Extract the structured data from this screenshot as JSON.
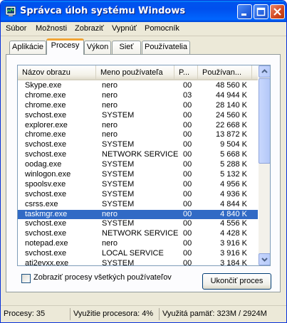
{
  "window": {
    "title": "Správca úloh systému Windows"
  },
  "menu": [
    "Súbor",
    "Možnosti",
    "Zobraziť",
    "Vypnúť",
    "Pomocník"
  ],
  "tabs": [
    "Aplikácie",
    "Procesy",
    "Výkon",
    "Sieť",
    "Používatelia"
  ],
  "active_tab": "Procesy",
  "columns": [
    "Názov obrazu",
    "Meno používateľa",
    "P...",
    "Používan..."
  ],
  "processes": [
    {
      "name": "Skype.exe",
      "user": "nero",
      "cpu": "00",
      "mem": "48 560 K"
    },
    {
      "name": "chrome.exe",
      "user": "nero",
      "cpu": "03",
      "mem": "44 944 K"
    },
    {
      "name": "chrome.exe",
      "user": "nero",
      "cpu": "00",
      "mem": "28 140 K"
    },
    {
      "name": "svchost.exe",
      "user": "SYSTEM",
      "cpu": "00",
      "mem": "24 560 K"
    },
    {
      "name": "explorer.exe",
      "user": "nero",
      "cpu": "00",
      "mem": "22 668 K"
    },
    {
      "name": "chrome.exe",
      "user": "nero",
      "cpu": "00",
      "mem": "13 872 K"
    },
    {
      "name": "svchost.exe",
      "user": "SYSTEM",
      "cpu": "00",
      "mem": "9 504 K"
    },
    {
      "name": "svchost.exe",
      "user": "NETWORK SERVICE",
      "cpu": "00",
      "mem": "5 668 K"
    },
    {
      "name": "oodag.exe",
      "user": "SYSTEM",
      "cpu": "00",
      "mem": "5 288 K"
    },
    {
      "name": "winlogon.exe",
      "user": "SYSTEM",
      "cpu": "00",
      "mem": "5 132 K"
    },
    {
      "name": "spoolsv.exe",
      "user": "SYSTEM",
      "cpu": "00",
      "mem": "4 956 K"
    },
    {
      "name": "svchost.exe",
      "user": "SYSTEM",
      "cpu": "00",
      "mem": "4 936 K"
    },
    {
      "name": "csrss.exe",
      "user": "SYSTEM",
      "cpu": "00",
      "mem": "4 844 K"
    },
    {
      "name": "taskmgr.exe",
      "user": "nero",
      "cpu": "00",
      "mem": "4 840 K",
      "selected": true
    },
    {
      "name": "svchost.exe",
      "user": "SYSTEM",
      "cpu": "00",
      "mem": "4 556 K"
    },
    {
      "name": "svchost.exe",
      "user": "NETWORK SERVICE",
      "cpu": "00",
      "mem": "4 428 K"
    },
    {
      "name": "notepad.exe",
      "user": "nero",
      "cpu": "00",
      "mem": "3 916 K"
    },
    {
      "name": "svchost.exe",
      "user": "LOCAL SERVICE",
      "cpu": "00",
      "mem": "3 916 K"
    },
    {
      "name": "ati2evxx.exe",
      "user": "SYSTEM",
      "cpu": "00",
      "mem": "3 184 K"
    }
  ],
  "show_all_label": "Zobraziť procesy všetkých používateľov",
  "show_all_checked": false,
  "end_process_label": "Ukončiť proces",
  "status": {
    "processes": "Procesy: 35",
    "cpu": "Využitie procesora: 4%",
    "memory": "Využitá pamäť: 323M / 2924M"
  },
  "icons": {
    "app": "task-manager-icon",
    "minimize": "minimize-icon",
    "maximize": "maximize-icon",
    "close": "close-icon"
  },
  "colors": {
    "selection": "#316ac5",
    "title_bar": "#0053ee",
    "close_button": "#d2461f"
  }
}
